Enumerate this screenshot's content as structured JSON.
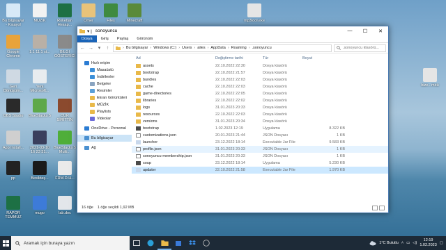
{
  "desktop_icons_left": [
    {
      "label": "Bu bilgisayar - Kısayol",
      "color": "#d7e9f7"
    },
    {
      "label": "MÜZİK",
      "color": "#f2f2f2"
    },
    {
      "label": "Roketlan Hesap...",
      "color": "#1d7044"
    },
    {
      "label": "Google Chrome",
      "color": "#e8a33a"
    },
    {
      "label": "1:1 11:1 st...",
      "color": "#b9b0a6"
    },
    {
      "label": "BİLGİ GÖSTERİCİ",
      "color": "#8a8a8a"
    },
    {
      "label": "Geri Dönüşüm...",
      "color": "#cfd9e3"
    },
    {
      "label": "Yeni Microsoft...",
      "color": "#e8ecef"
    },
    {
      "label": "OBS Studio",
      "color": "#2a2a2a"
    },
    {
      "label": "BlueStacks 5",
      "color": "#5ea84a"
    },
    {
      "label": "CUR SİRİTTİN",
      "color": "#8b4a2e"
    },
    {
      "label": "App Install...",
      "color": "#cfcfcf"
    },
    {
      "label": "2021-03-10 16 23 31...",
      "color": "#3a3f5e"
    },
    {
      "label": "BlueStacks 5 Multi...",
      "color": "#4fae3a"
    },
    {
      "label": "pp",
      "color": "#222222"
    },
    {
      "label": "Besiktaş...",
      "color": "#1a1a1a"
    },
    {
      "label": "FRM.D.H...",
      "color": "#eaeaea"
    },
    {
      "label": "RAPOR TEMMUZ",
      "color": "#1d7044"
    },
    {
      "label": "mugo",
      "color": "#3d7bd8"
    },
    {
      "label": "lab.doc",
      "color": "#e3e6ea"
    }
  ],
  "desktop_icons_top": [
    {
      "label": "Ömer",
      "color": "#e8c37a"
    },
    {
      "label": "Files",
      "color": "#3f8a3f"
    },
    {
      "label": "Minecraft",
      "color": "#5a8a3a"
    },
    {
      "label": "mp3tool.exe",
      "color": "#e5e5e5"
    }
  ],
  "desktop_icon_right": {
    "label": "bize...mıtü",
    "color": "#e5e5e5"
  },
  "window": {
    "title": "sonoyuncu",
    "qat": "▾ |",
    "controls": {
      "minimize": "—",
      "maximize": "☐",
      "close": "✕"
    },
    "ribbon_tabs": [
      "Dosya",
      "Giriş",
      "Paylaş",
      "Görünüm"
    ],
    "nav_back": "←",
    "nav_forward": "→",
    "nav_recent": "▾",
    "nav_up": "↑",
    "breadcrumb": [
      "Bu bilgisayar",
      "Windows (C:)",
      "Users",
      "ailes",
      "AppData",
      "Roaming",
      ".sonoyuncu"
    ],
    "search_placeholder": ".sonoyuncu klasörü...",
    "sidebar": [
      {
        "label": "Hızlı erişim",
        "icon": "star-icon",
        "color": "#2b7cd3",
        "sub": false
      },
      {
        "label": "Masaüstü",
        "icon": "desktop-icon",
        "color": "#3c8fd8",
        "sub": true
      },
      {
        "label": "İndirilenler",
        "icon": "download-icon",
        "color": "#3c8fd8",
        "sub": true
      },
      {
        "label": "Belgeler",
        "icon": "documents-icon",
        "color": "#8aa4c0",
        "sub": true
      },
      {
        "label": "Resimler",
        "icon": "pictures-icon",
        "color": "#5aa0d8",
        "sub": true
      },
      {
        "label": "Ekran Görüntüleri",
        "icon": "folder-icon",
        "color": "#e9b949",
        "sub": true
      },
      {
        "label": "MÜZİK",
        "icon": "folder-icon",
        "color": "#e9b949",
        "sub": true
      },
      {
        "label": "Playlists",
        "icon": "folder-icon",
        "color": "#e9b949",
        "sub": true
      },
      {
        "label": "Videolar",
        "icon": "videos-icon",
        "color": "#6a6ad8",
        "sub": true
      },
      {
        "label": "OneDrive - Personal",
        "icon": "onedrive-icon",
        "color": "#2b7cd3",
        "sub": false
      },
      {
        "label": "Bu bilgisayar",
        "icon": "computer-icon",
        "color": "#4a90d0",
        "sub": false
      },
      {
        "label": "Ağ",
        "icon": "network-icon",
        "color": "#4a90d0",
        "sub": false
      }
    ],
    "columns": {
      "name": "Ad",
      "date": "Değiştirme tarihi",
      "type": "Tür",
      "size": "Boyut"
    },
    "files": [
      {
        "name": "assets",
        "date": "22.10.2022 22:30",
        "type": "Dosya klasörü",
        "size": "",
        "kind": "folder"
      },
      {
        "name": "bootstrap",
        "date": "22.10.2022 21:57",
        "type": "Dosya klasörü",
        "size": "",
        "kind": "folder"
      },
      {
        "name": "bundles",
        "date": "22.10.2022 22:03",
        "type": "Dosya klasörü",
        "size": "",
        "kind": "folder"
      },
      {
        "name": "cache",
        "date": "22.10.2022 22:03",
        "type": "Dosya klasörü",
        "size": "",
        "kind": "folder"
      },
      {
        "name": "game-directories",
        "date": "22.10.2022 22:05",
        "type": "Dosya klasörü",
        "size": "",
        "kind": "folder"
      },
      {
        "name": "libraries",
        "date": "22.10.2022 22:02",
        "type": "Dosya klasörü",
        "size": "",
        "kind": "folder"
      },
      {
        "name": "logs",
        "date": "31.01.2023 20:33",
        "type": "Dosya klasörü",
        "size": "",
        "kind": "folder"
      },
      {
        "name": "resources",
        "date": "22.10.2022 22:03",
        "type": "Dosya klasörü",
        "size": "",
        "kind": "folder"
      },
      {
        "name": "versions",
        "date": "31.01.2023 20:34",
        "type": "Dosya klasörü",
        "size": "",
        "kind": "folder"
      },
      {
        "name": "bootstrap",
        "date": "1.02.2023 12:19",
        "type": "Uygulama",
        "size": "8.322 KB",
        "kind": "app"
      },
      {
        "name": "customizations.json",
        "date": "20.01.2023 21:44",
        "type": "JSON Dosyası",
        "size": "1 KB",
        "kind": "file"
      },
      {
        "name": "launcher",
        "date": "23.12.2022 18:14",
        "type": "Executable Jar File",
        "size": "9.583 KB",
        "kind": "jar"
      },
      {
        "name": "profile.json",
        "date": "31.01.2023 20:33",
        "type": "JSON Dosyası",
        "size": "1 KB",
        "kind": "file"
      },
      {
        "name": "sonoyuncu-membership.json",
        "date": "31.01.2023 20:33",
        "type": "JSON Dosyası",
        "size": "1 KB",
        "kind": "file"
      },
      {
        "name": "soup",
        "date": "23.12.2022 18:14",
        "type": "Uygulama",
        "size": "5.230 KB",
        "kind": "app"
      },
      {
        "name": "updater",
        "date": "22.10.2022 21:58",
        "type": "Executable Jar File",
        "size": "1.970 KB",
        "kind": "jar"
      }
    ],
    "status_count": "16 öğe",
    "status_selected": "1 öğe seçildi  1,92 MB"
  },
  "taskbar": {
    "search_placeholder": "Aramak için buraya yazın",
    "weather": "1°C  Bulutlu",
    "time": "12:19",
    "date": "1.02.2023"
  }
}
